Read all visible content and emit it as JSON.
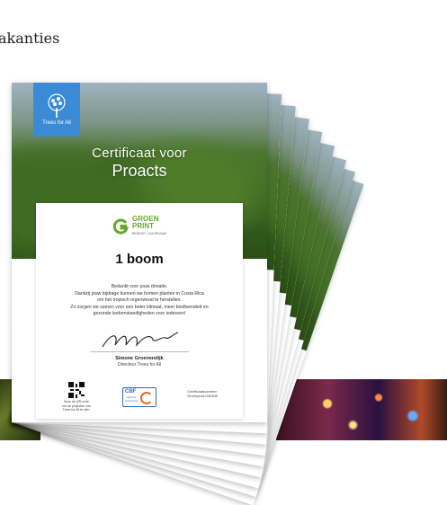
{
  "background": {
    "partial_text": "akanties"
  },
  "certificate": {
    "org_name": "Trees for All",
    "title_line1": "Certificaat voor",
    "title_line2": "Proacts",
    "sponsor_logo": {
      "line1": "GROEN",
      "line2": "PRINT",
      "tagline": "BEWUST • DUURZAAM"
    },
    "amount": "1 boom",
    "thanks": [
      "Bedankt voor jouw donatie.",
      "Dankzij jouw bijdrage kunnen we bomen planten in Costa Rica",
      "om het tropisch regenwoud te herstellen.",
      "Zo zorgen we samen voor een beter klimaat, meer biodiversiteit en",
      "gezonde leefomstandigheden voor iedereen!"
    ],
    "signer_name": "Simone Groenendijk",
    "signer_role": "Directeur Trees for All",
    "qr_caption": [
      "Scan de QR-code",
      "om de projecten van",
      "Trees for All te zien."
    ],
    "cbf": {
      "name": "CBF",
      "sub": [
        "Erkend",
        "Goed Doel"
      ]
    },
    "certificate_number_label": "Certificaatnummer:",
    "certificate_number": "Groenprint-000408"
  },
  "colors": {
    "badge_blue": "#3a8ad6",
    "brand_green": "#66a82a",
    "cbf_blue": "#2f6dba",
    "cbf_orange": "#e06a2a"
  }
}
